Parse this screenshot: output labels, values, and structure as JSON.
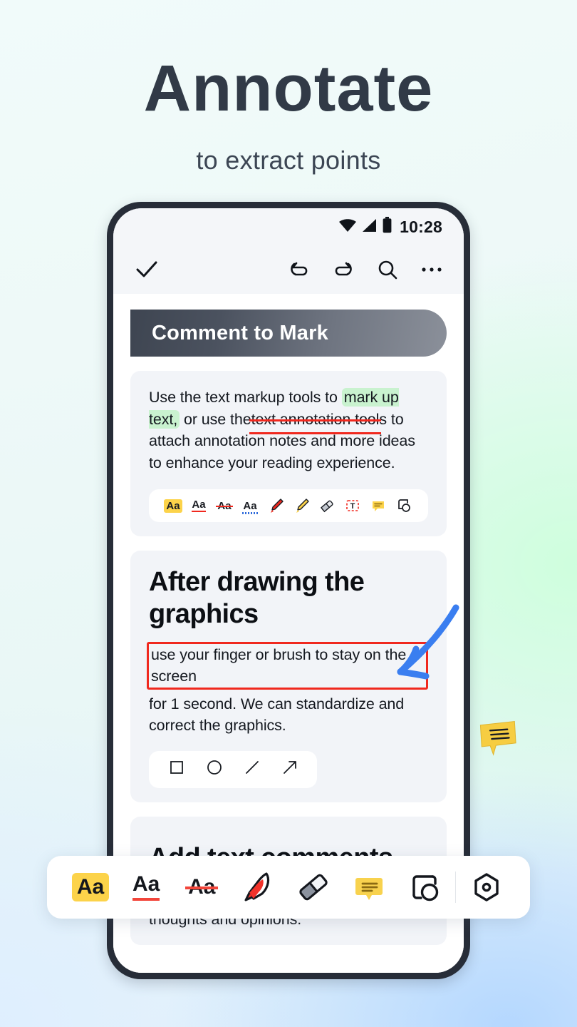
{
  "hero": {
    "title": "Annotate",
    "subtitle": "to extract points"
  },
  "colors": {
    "accent_yellow": "#fcd34a",
    "accent_red": "#f0281e",
    "accent_blue": "#3a7ef0",
    "highlight_green": "#c9f2cf",
    "frame_dark": "#272d38"
  },
  "phone": {
    "statusbar": {
      "time": "10:28",
      "icons": [
        "wifi-icon",
        "signal-icon",
        "battery-icon"
      ]
    },
    "toolbar": {
      "confirm": "check-icon",
      "undo": "undo-icon",
      "redo": "redo-icon",
      "search": "search-icon",
      "more": "more-options-icon"
    },
    "document": {
      "section_header": "Comment to Mark",
      "card1": {
        "text_part1": "Use the text markup tools to ",
        "highlighted": "mark up text,",
        "text_part2": " or use the",
        "struck": "text annotation tool",
        "text_part3": "s to attach annotation notes and more ideas to enhance your reading experience.",
        "tools": [
          {
            "name": "highlight-text-tool",
            "label": "Aa"
          },
          {
            "name": "underline-text-tool",
            "label": "Aa"
          },
          {
            "name": "strikethrough-text-tool",
            "label": "Aa"
          },
          {
            "name": "squiggly-underline-text-tool",
            "label": "Aa"
          },
          {
            "name": "pen-tool",
            "label": ""
          },
          {
            "name": "highlighter-tool",
            "label": ""
          },
          {
            "name": "eraser-tool",
            "label": ""
          },
          {
            "name": "text-box-tool",
            "label": "T"
          },
          {
            "name": "comment-tool",
            "label": ""
          },
          {
            "name": "shapes-tool",
            "label": ""
          }
        ]
      },
      "card2": {
        "heading": "After drawing the graphics",
        "boxed_text": "use your finger or brush to stay on the screen",
        "body": "for 1 second. We can standardize and correct the graphics.",
        "shapes": [
          {
            "name": "square-shape-tool"
          },
          {
            "name": "circle-shape-tool"
          },
          {
            "name": "line-shape-tool"
          },
          {
            "name": "arrow-shape-tool"
          }
        ]
      },
      "card3": {
        "heading": "Add text comments",
        "body": "in the blank space to express your thoughts and opinions."
      }
    },
    "bottom_toolbar": [
      {
        "name": "highlight-tool",
        "label": "Aa"
      },
      {
        "name": "underline-tool",
        "label": "Aa"
      },
      {
        "name": "strikethrough-tool",
        "label": "Aa"
      },
      {
        "name": "marker-pen-tool",
        "label": ""
      },
      {
        "name": "eraser-tool",
        "label": ""
      },
      {
        "name": "note-comment-tool",
        "label": ""
      },
      {
        "name": "shapes-tool",
        "label": ""
      },
      {
        "name": "settings-tool",
        "label": ""
      }
    ]
  }
}
